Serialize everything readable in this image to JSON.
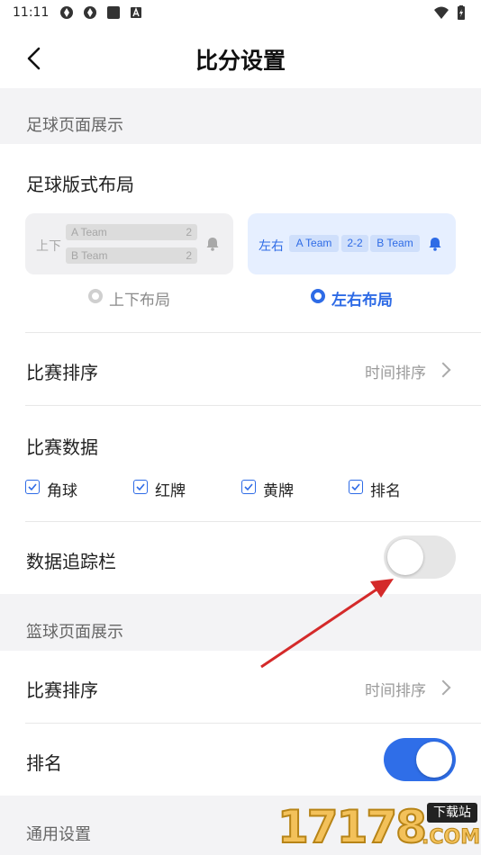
{
  "status_bar": {
    "time": "11:11"
  },
  "header": {
    "title": "比分设置"
  },
  "football_section": {
    "heading": "足球页面展示",
    "layout_title": "足球版式布局",
    "layout_vertical": {
      "side_label": "上下",
      "team_a": "A Team",
      "score_a": "2",
      "team_b": "B Team",
      "score_b": "2",
      "option_label": "上下布局"
    },
    "layout_horizontal": {
      "side_label": "左右",
      "team_a": "A Team",
      "score": "2-2",
      "team_b": "B Team",
      "option_label": "左右布局"
    },
    "selected_layout": "左右布局",
    "sort": {
      "label": "比赛排序",
      "value": "时间排序"
    },
    "data": {
      "label": "比赛数据",
      "options": [
        {
          "label": "角球",
          "checked": true
        },
        {
          "label": "红牌",
          "checked": true
        },
        {
          "label": "黄牌",
          "checked": true
        },
        {
          "label": "排名",
          "checked": true
        }
      ]
    },
    "tracker": {
      "label": "数据追踪栏",
      "enabled": false
    }
  },
  "basketball_section": {
    "heading": "篮球页面展示",
    "sort": {
      "label": "比赛排序",
      "value": "时间排序"
    },
    "ranking": {
      "label": "排名",
      "enabled": true
    }
  },
  "general_section": {
    "heading": "通用设置"
  },
  "watermark": {
    "text": "17178",
    "badge": "下载站",
    "suffix": ".COM"
  },
  "colors": {
    "accent": "#2e6be6",
    "toggle_on": "#2f6ee8",
    "toggle_off": "#e6e6e6",
    "section_bg": "#f3f3f5",
    "annotation_arrow": "#d42a2a"
  }
}
